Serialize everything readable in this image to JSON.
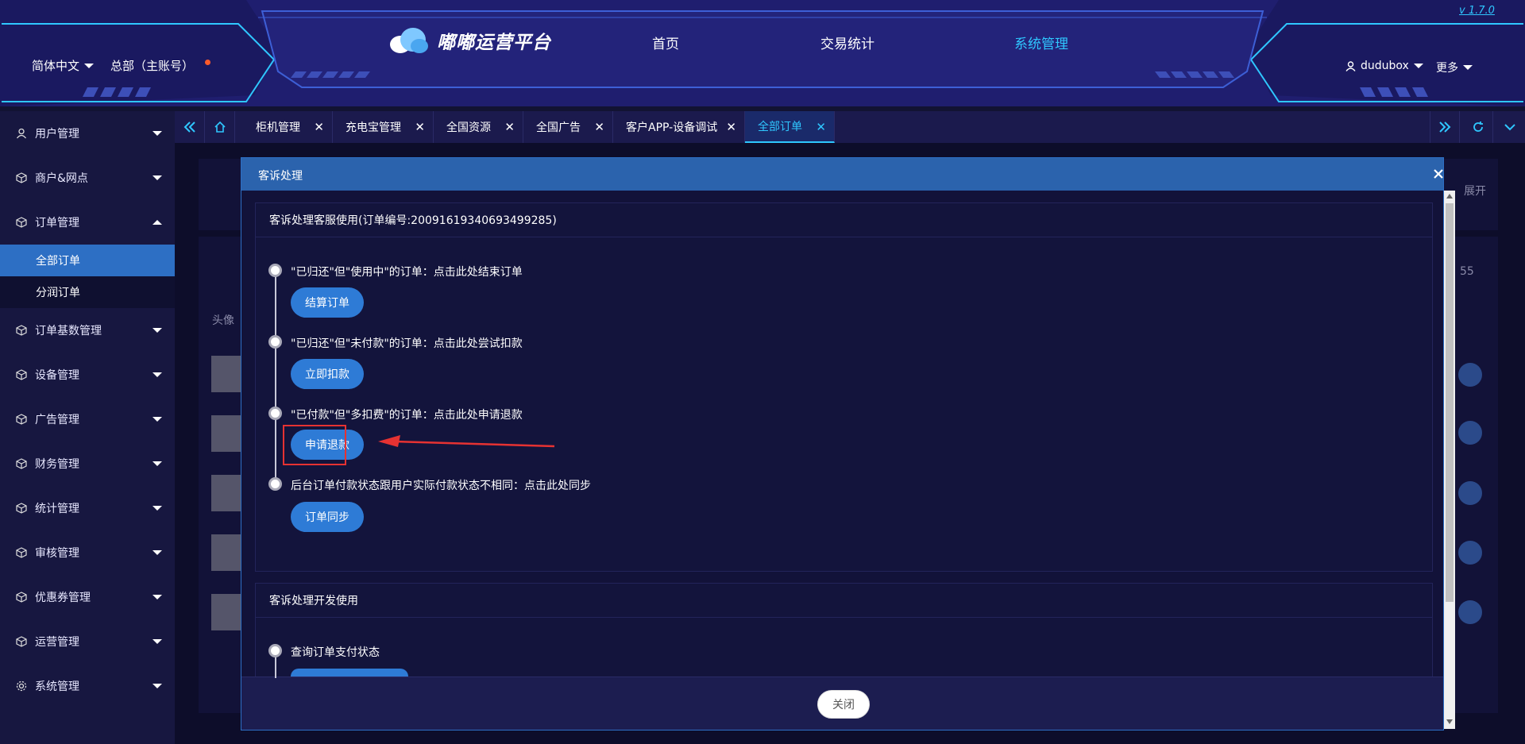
{
  "header": {
    "language": "简体中文",
    "org": "总部（主账号）",
    "brand_name": "嘟嘟运营平台",
    "nav": [
      "首页",
      "交易统计",
      "系统管理"
    ],
    "active_nav_index": 2,
    "version": "v 1.7.0",
    "username": "dudubox",
    "more": "更多",
    "accent_color": "#2fc7ff",
    "icons": [
      "cloud-logo-icon",
      "user-icon",
      "caret-down-icon"
    ]
  },
  "sidebar": {
    "items": [
      {
        "label": "用户管理",
        "icon": "user-icon"
      },
      {
        "label": "商户&网点",
        "icon": "cube-icon"
      },
      {
        "label": "订单管理",
        "icon": "cube-icon",
        "expanded": true
      },
      {
        "label": "订单基数管理",
        "icon": "cube-icon"
      },
      {
        "label": "设备管理",
        "icon": "cube-icon"
      },
      {
        "label": "广告管理",
        "icon": "cube-icon"
      },
      {
        "label": "财务管理",
        "icon": "cube-icon"
      },
      {
        "label": "统计管理",
        "icon": "cube-icon"
      },
      {
        "label": "审核管理",
        "icon": "cube-icon"
      },
      {
        "label": "优惠券管理",
        "icon": "cube-icon"
      },
      {
        "label": "运营管理",
        "icon": "cube-icon"
      },
      {
        "label": "系统管理",
        "icon": "gear-icon"
      }
    ],
    "order_sub": [
      {
        "label": "全部订单",
        "active": true
      },
      {
        "label": "分润订单",
        "active": false
      }
    ],
    "active_color": "#2d6fc4"
  },
  "tabs": {
    "items": [
      {
        "label": "柜机管理"
      },
      {
        "label": "充电宝管理"
      },
      {
        "label": "全国资源"
      },
      {
        "label": "全国广告"
      },
      {
        "label": "客户APP-设备调试"
      },
      {
        "label": "全部订单",
        "active": true
      }
    ]
  },
  "background": {
    "expand": "展开",
    "avatar_col": "头像",
    "count_fragment": "55"
  },
  "modal": {
    "title": "客诉处理",
    "panel1": {
      "title": "客诉处理客服使用(订单编号:20091619340693499285)",
      "steps": [
        {
          "text": "\"已归还\"但\"使用中\"的订单：点击此处结束订单",
          "button": "结算订单"
        },
        {
          "text": "\"已归还\"但\"未付款\"的订单：点击此处尝试扣款",
          "button": "立即扣款"
        },
        {
          "text": "\"已付款\"但\"多扣费\"的订单：点击此处申请退款",
          "button": "申请退款",
          "highlighted": true
        },
        {
          "text": "后台订单付款状态跟用户实际付款状态不相同：点击此处同步",
          "button": "订单同步"
        }
      ]
    },
    "panel2": {
      "title": "客诉处理开发使用",
      "steps": [
        {
          "text": "查询订单支付状态"
        }
      ]
    },
    "close_label": "关闭",
    "header_color": "#2b63ad",
    "button_color": "#2e7bd6",
    "highlight_color": "#e63232"
  }
}
